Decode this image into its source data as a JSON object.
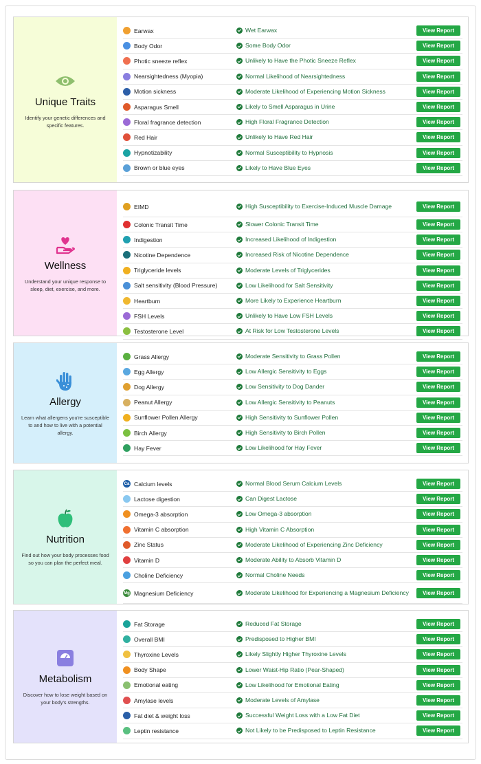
{
  "button_label": "View Report",
  "colors": {
    "button": "#24a845",
    "result_text": "#1f6e3c",
    "unique_bg": "#f6fdd8",
    "wellness_bg": "#fde0f4",
    "allergy_bg": "#d5effb",
    "nutrition_bg": "#d8f6ea",
    "metabolism_bg": "#e4e2fb"
  },
  "sections": [
    {
      "title": "Unique Traits",
      "description": "Identify your genetic differences and specific features.",
      "icon": "eye-icon",
      "rows": [
        {
          "trait": "Earwax",
          "result": "Wet Earwax",
          "icon": "ear-icon",
          "color": "#f0a030"
        },
        {
          "trait": "Body Odor",
          "result": "Some Body Odor",
          "icon": "odor-icon",
          "color": "#4a90e2"
        },
        {
          "trait": "Photic sneeze reflex",
          "result": "Unlikely to Have the Photic Sneeze Reflex",
          "icon": "sneeze-icon",
          "color": "#f07050"
        },
        {
          "trait": "Nearsightedness (Myopia)",
          "result": "Normal Likelihood of Nearsightedness",
          "icon": "glasses-icon",
          "color": "#8a7fe0"
        },
        {
          "trait": "Motion sickness",
          "result": "Moderate Likelihood of Experiencing Motion Sickness",
          "icon": "car-icon",
          "color": "#2d5fa8"
        },
        {
          "trait": "Asparagus Smell",
          "result": "Likely to Smell Asparagus in Urine",
          "icon": "asparagus-icon",
          "color": "#e05a2a"
        },
        {
          "trait": "Floral fragrance detection",
          "result": "High Floral Fragrance Detection",
          "icon": "flower-icon",
          "color": "#9b6ad6"
        },
        {
          "trait": "Red Hair",
          "result": "Unlikely to Have Red Hair",
          "icon": "red-hair-icon",
          "color": "#e0503a"
        },
        {
          "trait": "Hypnotizability",
          "result": "Normal Susceptibility to Hypnosis",
          "icon": "hypnosis-icon",
          "color": "#1aa3a3"
        },
        {
          "trait": "Brown or blue eyes",
          "result": "Likely to Have Blue Eyes",
          "icon": "eye-color-icon",
          "color": "#5aa0d8"
        }
      ]
    },
    {
      "title": "Wellness",
      "description": "Understand your unique response to sleep, diet, exercise, and more.",
      "icon": "heart-hand-icon",
      "rows": [
        {
          "trait": "EIMD",
          "result": "High Susceptibility to Exercise-Induced Muscle Damage",
          "icon": "muscle-icon",
          "color": "#e0a020"
        },
        {
          "trait": "Colonic Transit Time",
          "result": "Slower Colonic Transit Time",
          "icon": "colon-icon",
          "color": "#e03030"
        },
        {
          "trait": "Indigestion",
          "result": "Increased Likelihood of Indigestion",
          "icon": "stomach-icon",
          "color": "#20a0b0"
        },
        {
          "trait": "Nicotine Dependence",
          "result": "Increased Risk of Nicotine Dependence",
          "icon": "cigarette-icon",
          "color": "#1a6f7a"
        },
        {
          "trait": "Triglyceride levels",
          "result": "Moderate Levels of Triglycerides",
          "icon": "triglyceride-icon",
          "color": "#f0b020"
        },
        {
          "trait": "Salt sensitivity (Blood Pressure)",
          "result": "Low Likelihood for Salt Sensitivity",
          "icon": "salt-icon",
          "color": "#4a90d8"
        },
        {
          "trait": "Heartburn",
          "result": "More Likely to Experience Heartburn",
          "icon": "heartburn-icon",
          "color": "#f0b830"
        },
        {
          "trait": "FSH Levels",
          "result": "Unlikely to Have Low FSH Levels",
          "icon": "fsh-icon",
          "color": "#9b6ad6"
        },
        {
          "trait": "Testosterone Level",
          "result": "At Risk for Low Testosterone Levels",
          "icon": "testosterone-icon",
          "color": "#8bbf40"
        }
      ]
    },
    {
      "title": "Allergy",
      "description": "Learn what allergens you're susceptible to and how to live with a potential allergy.",
      "icon": "hand-icon",
      "rows": [
        {
          "trait": "Grass Allergy",
          "result": "Moderate Sensitivity to Grass Pollen",
          "icon": "grass-icon",
          "color": "#5ab040"
        },
        {
          "trait": "Egg Allergy",
          "result": "Low Allergic Sensitivity to Eggs",
          "icon": "egg-icon",
          "color": "#5aa8e0"
        },
        {
          "trait": "Dog Allergy",
          "result": "Low Sensitivity to Dog Dander",
          "icon": "dog-icon",
          "color": "#e0a030"
        },
        {
          "trait": "Peanut Allergy",
          "result": "Low Allergic Sensitivity to Peanuts",
          "icon": "peanut-icon",
          "color": "#d8b060"
        },
        {
          "trait": "Sunflower Pollen Allergy",
          "result": "High Sensitivity to Sunflower Pollen",
          "icon": "sunflower-icon",
          "color": "#f0b020"
        },
        {
          "trait": "Birch Allergy",
          "result": "High Sensitivity to Birch Pollen",
          "icon": "birch-icon",
          "color": "#7ac040"
        },
        {
          "trait": "Hay Fever",
          "result": "Low Likelihood for Hay Fever",
          "icon": "hay-fever-icon",
          "color": "#30a060"
        }
      ]
    },
    {
      "title": "Nutrition",
      "description": "Find out how your body processes food so you can plan the perfect meal.",
      "icon": "apple-icon",
      "rows": [
        {
          "trait": "Calcium levels",
          "result": "Normal Blood Serum Calcium Levels",
          "icon": "calcium-icon",
          "color": "#1f5fa8",
          "symbol": "Ca"
        },
        {
          "trait": "Lactose digestion",
          "result": "Can Digest Lactose",
          "icon": "milk-icon",
          "color": "#8ac8f0"
        },
        {
          "trait": "Omega-3 absorption",
          "result": "Low Omega-3 absorption",
          "icon": "omega-icon",
          "color": "#f09020"
        },
        {
          "trait": "Vitamin C absorption",
          "result": "High Vitamin C Absorption",
          "icon": "vitamin-c-icon",
          "color": "#f07030"
        },
        {
          "trait": "Zinc Status",
          "result": "Moderate Likelihood of Experiencing Zinc Deficiency",
          "icon": "zinc-icon",
          "color": "#e05a2a"
        },
        {
          "trait": "Vitamin D",
          "result": "Moderate Ability to Absorb Vitamin D",
          "icon": "vitamin-d-icon",
          "color": "#e04040"
        },
        {
          "trait": "Choline Deficiency",
          "result": "Normal Choline Needs",
          "icon": "choline-icon",
          "color": "#4aa0e0"
        },
        {
          "trait": "Magnesium Deficiency",
          "result": "Moderate Likelihood for Experiencing a Magnesium Deficiency",
          "icon": "magnesium-icon",
          "color": "#3a8a3a",
          "symbol": "Mg"
        }
      ]
    },
    {
      "title": "Metabolism",
      "description": "Discover how to lose weight based on your body's strengths.",
      "icon": "scale-icon",
      "rows": [
        {
          "trait": "Fat Storage",
          "result": "Reduced Fat Storage",
          "icon": "fat-storage-icon",
          "color": "#1aa39a"
        },
        {
          "trait": "Overall BMI",
          "result": "Predisposed to Higher BMI",
          "icon": "bmi-icon",
          "color": "#30b0a0"
        },
        {
          "trait": "Thyroxine Levels",
          "result": "Likely Slightly Higher Thyroxine Levels",
          "icon": "thyroxine-icon",
          "color": "#f0c040"
        },
        {
          "trait": "Body Shape",
          "result": "Lower Waist-Hip Ratio (Pear-Shaped)",
          "icon": "body-shape-icon",
          "color": "#f09020"
        },
        {
          "trait": "Emotional eating",
          "result": "Low Likelihood for Emotional Eating",
          "icon": "emotional-eating-icon",
          "color": "#8ac070"
        },
        {
          "trait": "Amylase levels",
          "result": "Moderate Levels of Amylase",
          "icon": "amylase-icon",
          "color": "#e05050"
        },
        {
          "trait": "Fat diet & weight loss",
          "result": "Successful Weight Loss with a Low Fat Diet",
          "icon": "fat-diet-icon",
          "color": "#2a5fa8"
        },
        {
          "trait": "Leptin resistance",
          "result": "Not Likely to be Predisposed to Leptin Resistance",
          "icon": "leptin-icon",
          "color": "#5ac080"
        }
      ]
    }
  ]
}
